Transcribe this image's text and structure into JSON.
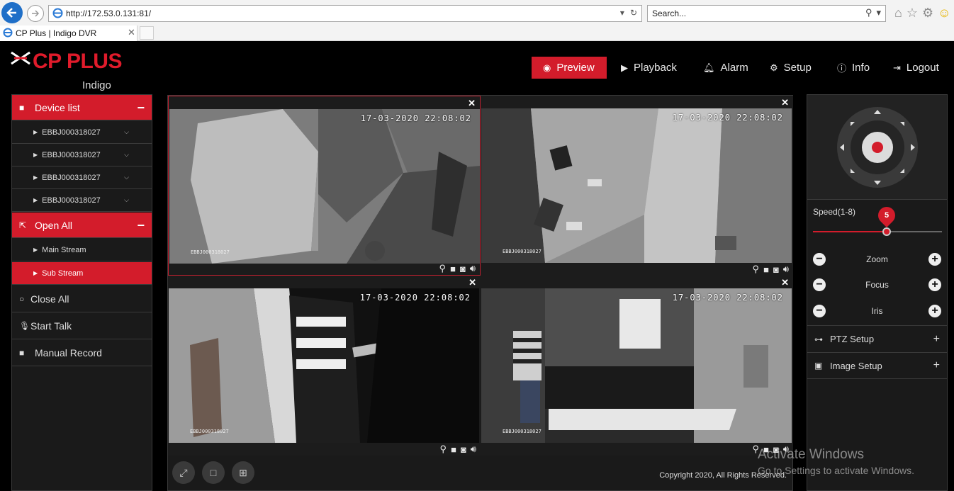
{
  "browser": {
    "url": "http://172.53.0.131:81/",
    "search_placeholder": "Search...",
    "tab_title": "CP Plus | Indigo DVR",
    "tab_close": "✕"
  },
  "header": {
    "brand": "CP PLUS",
    "sub": "Indigo",
    "nav": {
      "preview": "Preview",
      "playback": "Playback",
      "alarm": "Alarm",
      "setup": "Setup",
      "info": "Info",
      "logout": "Logout"
    }
  },
  "left": {
    "device_list": "Device list",
    "devices": [
      "EBBJ000318027",
      "EBBJ000318027",
      "EBBJ000318027",
      "EBBJ000318027"
    ],
    "open_all": "Open All",
    "main_stream": "Main Stream",
    "sub_stream": "Sub Stream",
    "close_all": "Close All",
    "start_talk": "Start Talk",
    "manual_record": "Manual Record"
  },
  "video": {
    "timestamps": [
      "17-03-2020 22:08:02",
      "17-03-2020 22:08:02",
      "17-03-2020 22:08:02",
      "17-03-2020 22:08:02"
    ],
    "camera_labels": [
      "EBBJ000318027",
      "EBBJ000318027",
      "EBBJ000318027",
      "EBBJ000318027"
    ],
    "copyright": "Copyright 2020, All Rights Reserved."
  },
  "ptz": {
    "speed_label": "Speed(1-8)",
    "speed_value": "5",
    "speed_fraction": 0.57,
    "zoom": "Zoom",
    "focus": "Focus",
    "iris": "Iris",
    "ptz_setup": "PTZ Setup",
    "image_setup": "Image Setup"
  },
  "watermark": {
    "line1": "Activate Windows",
    "line2": "Go to Settings to activate Windows."
  },
  "colors": {
    "accent": "#d31c2b",
    "panel": "#1a1a1a",
    "background": "#000000"
  }
}
